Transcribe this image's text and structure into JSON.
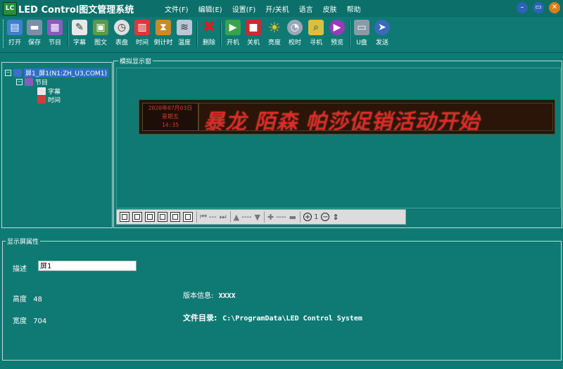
{
  "window": {
    "app_logo": "LC",
    "title": "LED Control图文管理系统",
    "menu": [
      "文件(F)",
      "编辑(E)",
      "设置(F)",
      "开/关机",
      "语言",
      "皮肤",
      "帮助"
    ]
  },
  "toolbar": {
    "buttons": [
      {
        "label": "打开",
        "icon": "open-folder-icon",
        "color": "#3f7fd0"
      },
      {
        "label": "保存",
        "icon": "save-disk-icon",
        "color": "#7a8fa8"
      },
      {
        "label": "节目",
        "icon": "program-icon",
        "color": "#8a5bbf"
      },
      {
        "label": "字幕",
        "icon": "subtitle-icon",
        "color": "#e8e8e8"
      },
      {
        "label": "图文",
        "icon": "image-text-icon",
        "color": "#5a9a4a"
      },
      {
        "label": "表盘",
        "icon": "clock-dial-icon",
        "color": "#e0e0e0"
      },
      {
        "label": "时间",
        "icon": "calendar-icon",
        "color": "#d83a3a"
      },
      {
        "label": "倒计时",
        "icon": "hourglass-icon",
        "color": "#c88a2a"
      },
      {
        "label": "温度",
        "icon": "temperature-icon",
        "color": "#b8c8d8"
      },
      {
        "label": "删除",
        "icon": "delete-icon",
        "color": "#d42020"
      },
      {
        "label": "开机",
        "icon": "power-on-icon",
        "color": "#3aa34a"
      },
      {
        "label": "关机",
        "icon": "power-off-icon",
        "color": "#c03030"
      },
      {
        "label": "亮度",
        "icon": "brightness-icon",
        "color": "#f0c020"
      },
      {
        "label": "校时",
        "icon": "time-sync-icon",
        "color": "#9aa8b8"
      },
      {
        "label": "寻机",
        "icon": "find-device-icon",
        "color": "#d8c040"
      },
      {
        "label": "预览",
        "icon": "preview-play-icon",
        "color": "#9a3ab8"
      },
      {
        "label": "U盘",
        "icon": "usb-drive-icon",
        "color": "#8a9aa8"
      },
      {
        "label": "发送",
        "icon": "send-icon",
        "color": "#3a6ab8"
      }
    ]
  },
  "tree": {
    "screen": "屏1_屏1(N1:ZH_U3,COM1)",
    "program": "节目",
    "items": [
      "字幕",
      "时间"
    ]
  },
  "simulator": {
    "title": "模拟显示窗",
    "led_date": "2020年07月03日",
    "led_weekday": "星期五",
    "led_time": "14:35",
    "led_text": "暴龙 陌森 帕莎促销活动开始",
    "toolbar": {
      "h_dashes": "---",
      "v_dashes": "----",
      "zoom_dashes": "----",
      "zoom_level": "1"
    }
  },
  "properties": {
    "title": "显示屏属性",
    "description_label": "描述",
    "description_value": "屏1",
    "height_label": "高度",
    "height_value": "48",
    "width_label": "宽度",
    "width_value": "704",
    "version_label": "版本信息:",
    "version_value": "XXXX",
    "folder_label": "文件目录:",
    "folder_value": "C:\\ProgramData\\LED Control System"
  }
}
